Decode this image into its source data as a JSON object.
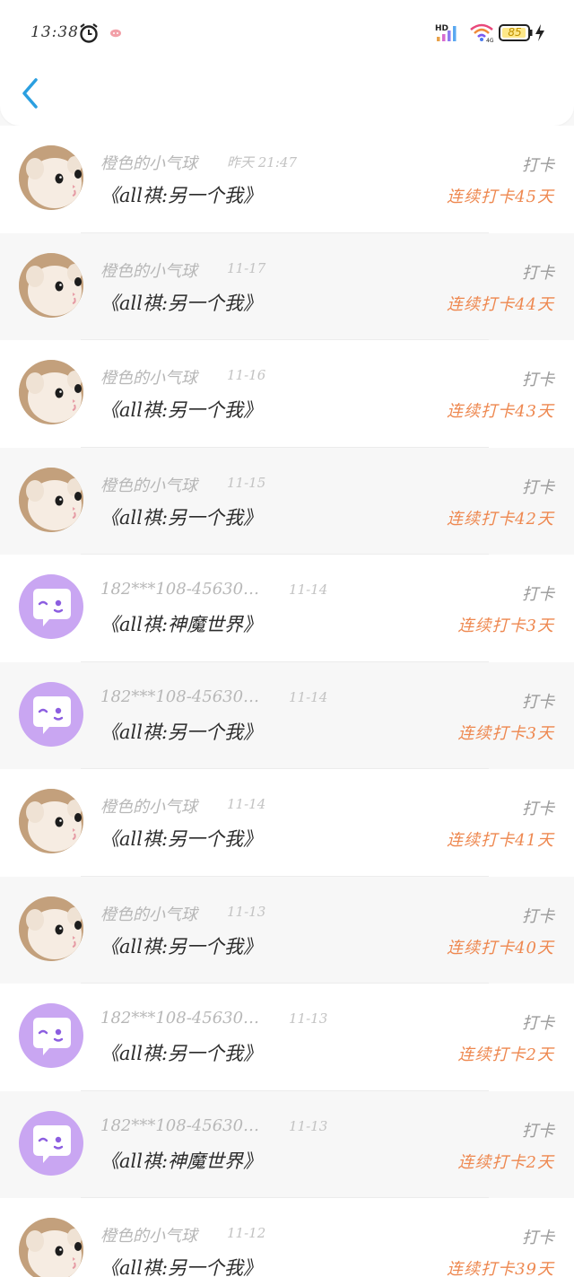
{
  "status_bar": {
    "time": "13:38",
    "battery": "85",
    "icons": [
      "alarm-icon",
      "notification-icon",
      "hd-signal-icon",
      "wifi-icon",
      "battery-icon",
      "charging-icon"
    ]
  },
  "header": {
    "back_icon": "chevron-left-icon"
  },
  "colors": {
    "accent_blue": "#2b9fe0",
    "streak_orange": "#ee8850",
    "avatar_purple": "#c9a6f2",
    "name_gray": "#b7b7b7",
    "title_dark": "#2b2b2b"
  },
  "feed": [
    {
      "user": "橙色的小气球",
      "time": "昨天 21:47",
      "avatar": "cat-avatar",
      "title": "《all祺:另一个我》",
      "action": "打卡",
      "streak": "连续打卡45天"
    },
    {
      "user": "橙色的小气球",
      "time": "11-17",
      "avatar": "cat-avatar",
      "title": "《all祺:另一个我》",
      "action": "打卡",
      "streak": "连续打卡44天"
    },
    {
      "user": "橙色的小气球",
      "time": "11-16",
      "avatar": "cat-avatar",
      "title": "《all祺:另一个我》",
      "action": "打卡",
      "streak": "连续打卡43天"
    },
    {
      "user": "橙色的小气球",
      "time": "11-15",
      "avatar": "cat-avatar",
      "title": "《all祺:另一个我》",
      "action": "打卡",
      "streak": "连续打卡42天"
    },
    {
      "user": "182***108-45630…",
      "time": "11-14",
      "avatar": "chat-bubble-avatar",
      "title": "《all祺:神魔世界》",
      "action": "打卡",
      "streak": "连续打卡3天"
    },
    {
      "user": "182***108-45630…",
      "time": "11-14",
      "avatar": "chat-bubble-avatar",
      "title": "《all祺:另一个我》",
      "action": "打卡",
      "streak": "连续打卡3天"
    },
    {
      "user": "橙色的小气球",
      "time": "11-14",
      "avatar": "cat-avatar",
      "title": "《all祺:另一个我》",
      "action": "打卡",
      "streak": "连续打卡41天"
    },
    {
      "user": "橙色的小气球",
      "time": "11-13",
      "avatar": "cat-avatar",
      "title": "《all祺:另一个我》",
      "action": "打卡",
      "streak": "连续打卡40天"
    },
    {
      "user": "182***108-45630…",
      "time": "11-13",
      "avatar": "chat-bubble-avatar",
      "title": "《all祺:另一个我》",
      "action": "打卡",
      "streak": "连续打卡2天"
    },
    {
      "user": "182***108-45630…",
      "time": "11-13",
      "avatar": "chat-bubble-avatar",
      "title": "《all祺:神魔世界》",
      "action": "打卡",
      "streak": "连续打卡2天"
    },
    {
      "user": "橙色的小气球",
      "time": "11-12",
      "avatar": "cat-avatar",
      "title": "《all祺:另一个我》",
      "action": "打卡",
      "streak": "连续打卡39天"
    }
  ]
}
